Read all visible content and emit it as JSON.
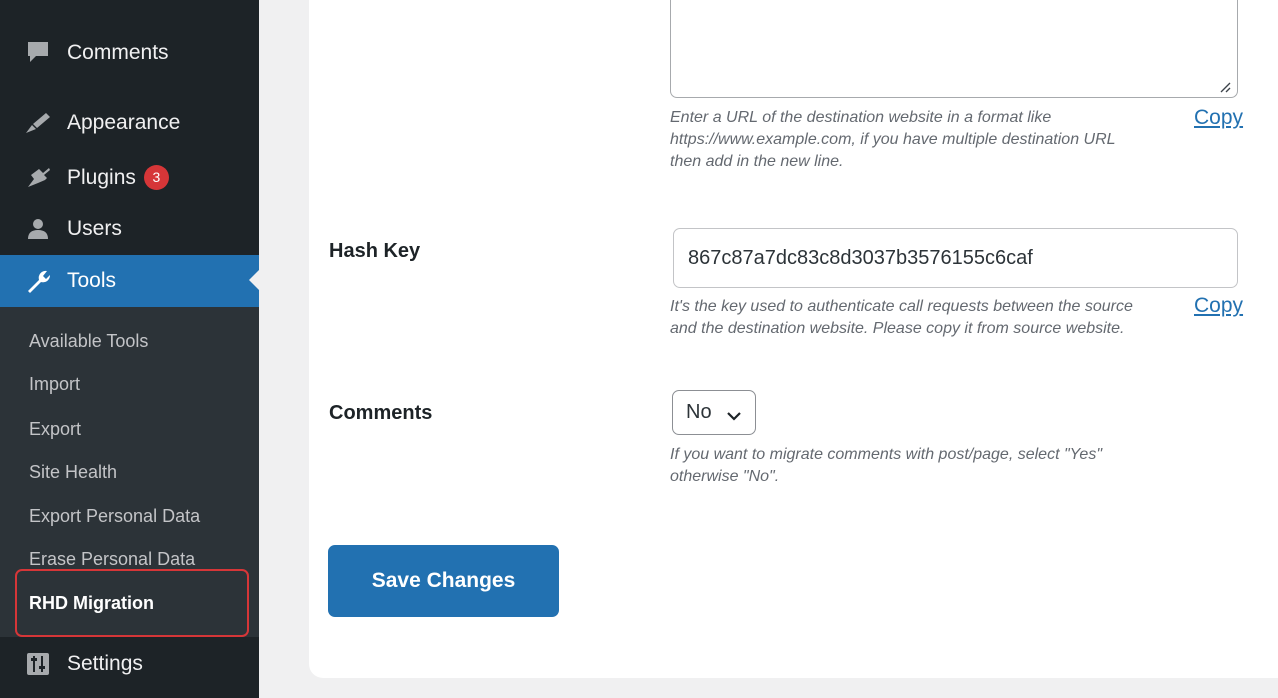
{
  "sidebar": {
    "menu": [
      {
        "label": "Comments",
        "icon": "comment-bubble-icon"
      },
      {
        "label": "Appearance",
        "icon": "paintbrush-icon"
      },
      {
        "label": "Plugins",
        "icon": "plug-icon",
        "badge": "3"
      },
      {
        "label": "Users",
        "icon": "user-icon"
      },
      {
        "label": "Tools",
        "icon": "wrench-icon",
        "active": true
      },
      {
        "label": "Settings",
        "icon": "sliders-icon"
      }
    ],
    "submenu": [
      "Available Tools",
      "Import",
      "Export",
      "Site Health",
      "Export Personal Data",
      "Erase Personal Data",
      "RHD Migration"
    ],
    "current_submenu": "RHD Migration"
  },
  "form": {
    "url_field": {
      "value": "",
      "description": [
        "Enter a URL of the destination website in a format like",
        "https://www.example.com, if you have multiple destination URL",
        "then add in the new line."
      ],
      "copy_label": "Copy"
    },
    "hash_key": {
      "label": "Hash Key",
      "value": "867c87a7dc83c8d3037b3576155c6caf",
      "description": [
        "It's the key used to authenticate call requests between the source",
        "and the destination website. Please copy it from source website."
      ],
      "copy_label": "Copy"
    },
    "comments": {
      "label": "Comments",
      "selected": "No",
      "description": [
        "If you want to migrate comments with post/page, select \"Yes\"",
        "otherwise \"No\"."
      ]
    },
    "save_label": "Save Changes"
  },
  "colors": {
    "sidebar_bg": "#1d2327",
    "submenu_bg": "#2c3338",
    "accent": "#2271b1",
    "badge": "#d63638",
    "highlight_border": "#d63638"
  }
}
